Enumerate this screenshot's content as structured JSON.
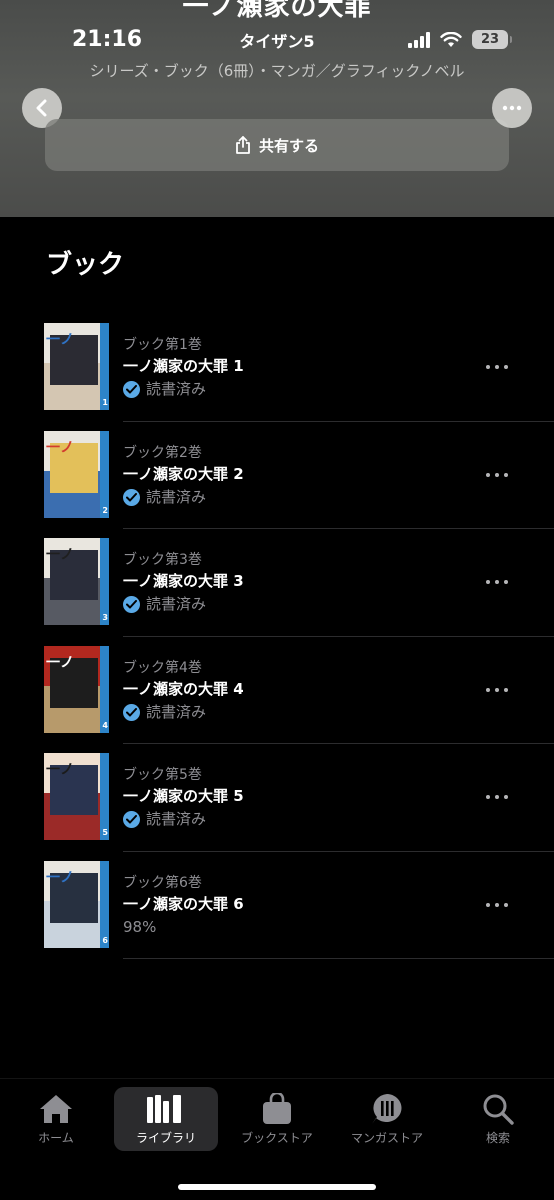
{
  "header": {
    "cut_title": "一ノ瀬家の大罪",
    "status_time": "21:16",
    "status_center": "タイザン5",
    "battery": "23",
    "subtitle": "シリーズ・ブック（6冊）・マンガ／グラフィックノベル",
    "share_label": "共有する"
  },
  "section_title": "ブック",
  "books": [
    {
      "label": "ブック第1巻",
      "title": "一ノ瀬家の大罪 1",
      "status": "読書済み",
      "cover_number": "1"
    },
    {
      "label": "ブック第2巻",
      "title": "一ノ瀬家の大罪 2",
      "status": "読書済み",
      "cover_number": "2"
    },
    {
      "label": "ブック第3巻",
      "title": "一ノ瀬家の大罪 3",
      "status": "読書済み",
      "cover_number": "3"
    },
    {
      "label": "ブック第4巻",
      "title": "一ノ瀬家の大罪 4",
      "status": "読書済み",
      "cover_number": "4"
    },
    {
      "label": "ブック第5巻",
      "title": "一ノ瀬家の大罪 5",
      "status": "読書済み",
      "cover_number": "5"
    },
    {
      "label": "ブック第6巻",
      "title": "一ノ瀬家の大罪 6",
      "status": "98%",
      "cover_number": "6"
    }
  ],
  "tabs": [
    {
      "label": "ホーム",
      "icon": "home-icon"
    },
    {
      "label": "ライブラリ",
      "icon": "library-icon",
      "active": true
    },
    {
      "label": "ブックストア",
      "icon": "bookstore-icon"
    },
    {
      "label": "マンガストア",
      "icon": "manga-store-icon"
    },
    {
      "label": "検索",
      "icon": "search-icon"
    }
  ],
  "colors": {
    "background": "#000000",
    "check_blue": "#5aa9e6",
    "secondary_text": "#8e8e93"
  }
}
